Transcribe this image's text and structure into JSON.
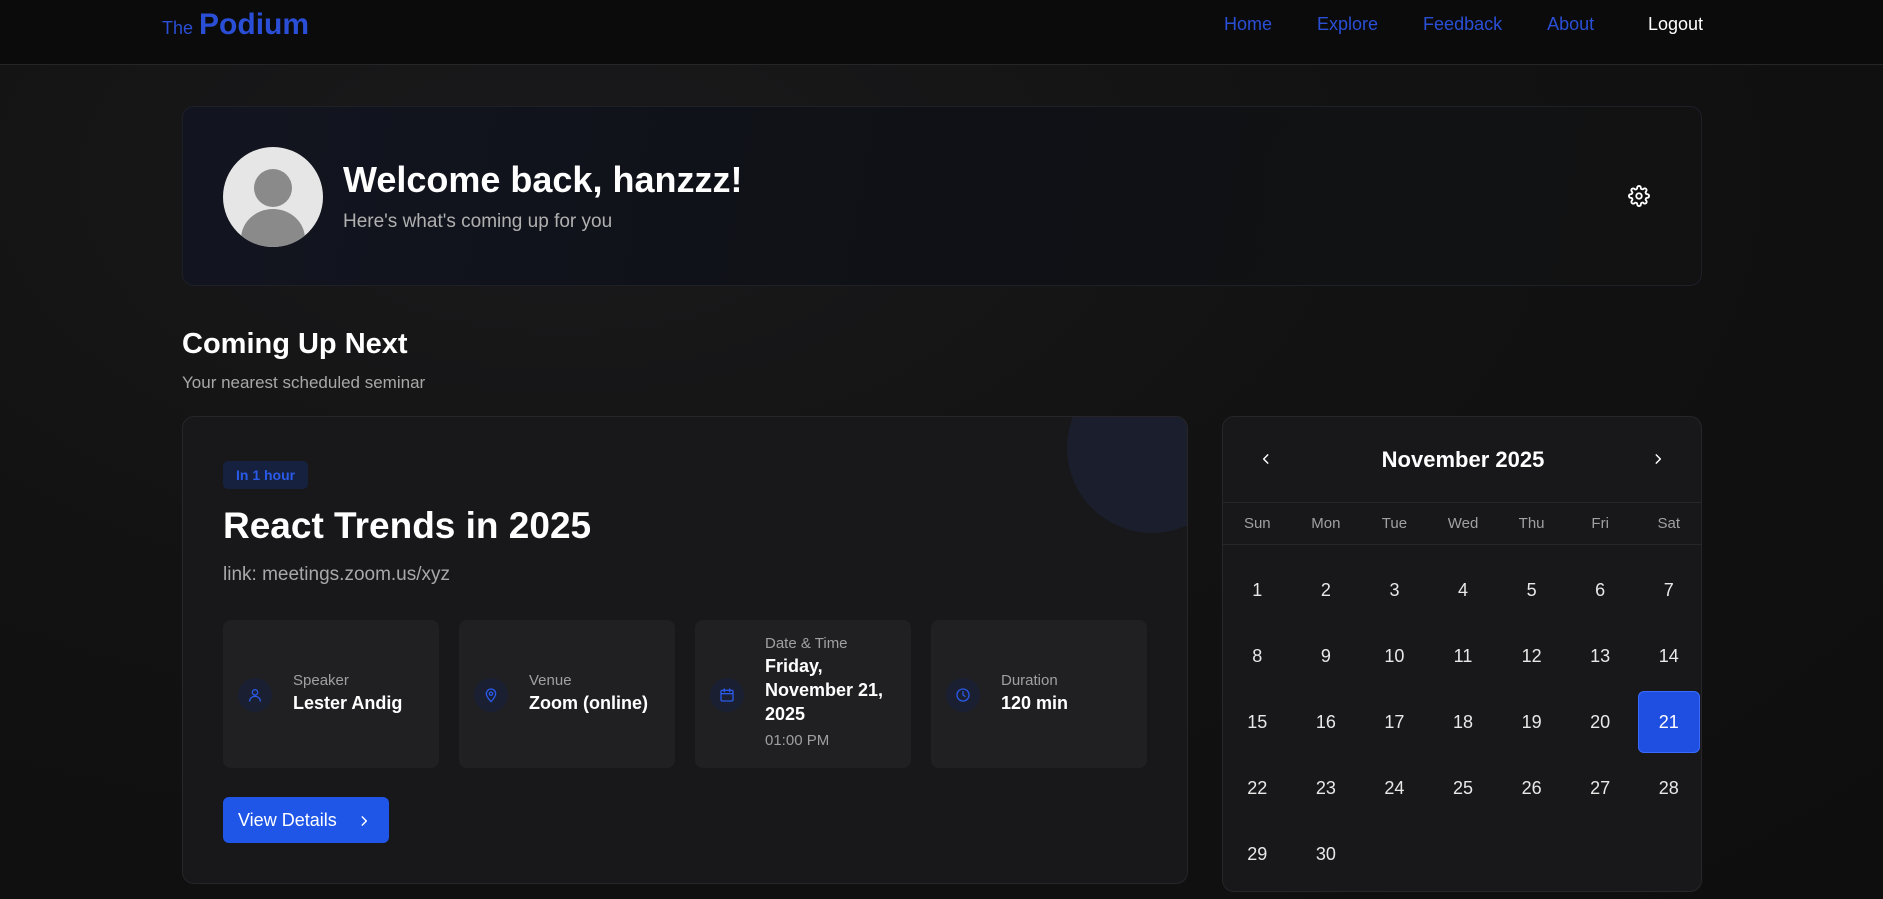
{
  "nav": {
    "brand_prefix": "The",
    "brand_name": "Podium",
    "links": [
      {
        "label": "Home"
      },
      {
        "label": "Explore"
      },
      {
        "label": "Feedback"
      },
      {
        "label": "About"
      }
    ],
    "logout": "Logout"
  },
  "welcome": {
    "title": "Welcome back, hanzzz!",
    "subtitle": "Here's what's coming up for you"
  },
  "section": {
    "title": "Coming Up Next",
    "subtitle": "Your nearest scheduled seminar"
  },
  "seminar": {
    "badge": "In 1 hour",
    "title": "React Trends in 2025",
    "link": "link: meetings.zoom.us/xyz",
    "speaker": {
      "label": "Speaker",
      "value": "Lester Andig",
      "icon": "user-icon"
    },
    "venue": {
      "label": "Venue",
      "value": "Zoom (online)",
      "icon": "location-pin-icon"
    },
    "datetime": {
      "label": "Date & Time",
      "value_line1": "Friday,",
      "value_line2": "November 21,",
      "value_line3": "2025",
      "time": "01:00 PM",
      "icon": "calendar-icon"
    },
    "duration": {
      "label": "Duration",
      "value": "120 min",
      "icon": "clock-icon"
    },
    "button": "View Details"
  },
  "calendar": {
    "month": "November 2025",
    "weekdays": [
      "Sun",
      "Mon",
      "Tue",
      "Wed",
      "Thu",
      "Fri",
      "Sat"
    ],
    "weeks": [
      [
        "1",
        "2",
        "3",
        "4",
        "5",
        "6",
        "7"
      ],
      [
        "8",
        "9",
        "10",
        "11",
        "12",
        "13",
        "14"
      ],
      [
        "15",
        "16",
        "17",
        "18",
        "19",
        "20",
        "21"
      ],
      [
        "22",
        "23",
        "24",
        "25",
        "26",
        "27",
        "28"
      ],
      [
        "29",
        "30",
        "",
        "",
        "",
        "",
        ""
      ]
    ],
    "selected": "21"
  },
  "colors": {
    "accent": "#1f56e8",
    "brand": "#2a4fd6",
    "background": "#121212"
  }
}
